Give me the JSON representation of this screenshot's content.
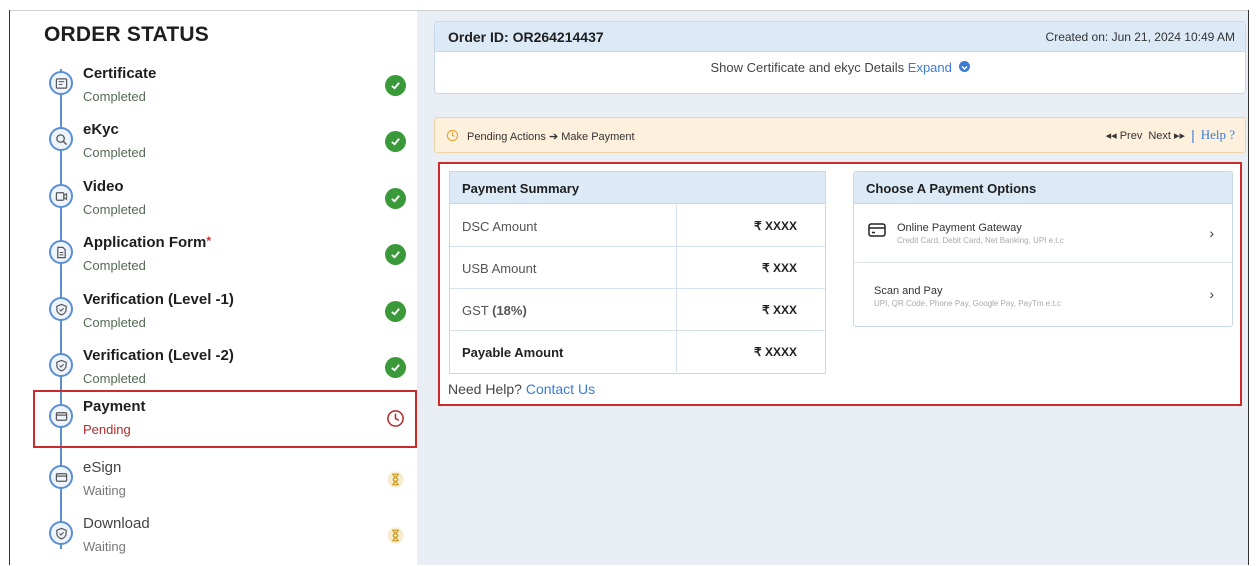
{
  "sidebar": {
    "title": "ORDER STATUS",
    "steps": [
      {
        "title": "Certificate",
        "status": "Completed"
      },
      {
        "title": "eKyc",
        "status": "Completed"
      },
      {
        "title": "Video",
        "status": "Completed"
      },
      {
        "title": "Application Form",
        "required_mark": "*",
        "status": "Completed"
      },
      {
        "title": "Verification (Level -1)",
        "status": "Completed"
      },
      {
        "title": "Verification (Level -2)",
        "status": "Completed"
      },
      {
        "title": "Payment",
        "status": "Pending"
      },
      {
        "title": "eSign",
        "status": "Waiting"
      },
      {
        "title": "Download",
        "status": "Waiting"
      }
    ]
  },
  "order": {
    "id_label": "Order ID: OR264214437",
    "created_on": "Created on: Jun 21, 2024 10:49 AM",
    "show_details": "Show Certificate and ekyc Details",
    "expand_label": "Expand"
  },
  "pending": {
    "text": "Pending Actions",
    "arrow": "➔",
    "action": "Make Payment",
    "prev": "Prev",
    "next": "Next",
    "help": "Help ?"
  },
  "summary": {
    "title": "Payment Summary",
    "rows": [
      {
        "label": "DSC Amount",
        "value": "₹ XXXX"
      },
      {
        "label": "USB Amount",
        "value": "₹ XXX"
      },
      {
        "label": "GST",
        "label_bold": "(18%)",
        "value": "₹ XXX"
      },
      {
        "label": "Payable Amount",
        "value": "₹ XXXX"
      }
    ]
  },
  "help": {
    "text": "Need Help?",
    "link": "Contact Us"
  },
  "options": {
    "title": "Choose A Payment Options",
    "items": [
      {
        "title": "Online Payment Gateway",
        "subtitle": "Credit Card, Debit Card, Net Banking, UPI e.t.c"
      },
      {
        "title": "Scan and Pay",
        "subtitle": "UPI, QR Code, Phone Pay, Google Pay, PayTm e.t.c"
      }
    ]
  },
  "colors": {
    "accent_blue": "#3a7bd5",
    "completed_green": "#3a9a3a",
    "pending_red": "#cc2b2b",
    "waiting_gold": "#c99a2a"
  }
}
